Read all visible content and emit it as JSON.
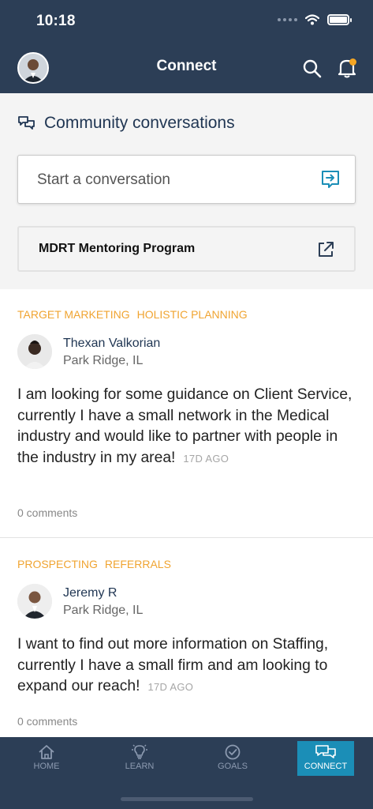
{
  "status_bar": {
    "time": "10:18"
  },
  "header": {
    "title": "Connect"
  },
  "community": {
    "title": "Community conversations",
    "start_placeholder": "Start a conversation",
    "mentoring_label": "MDRT Mentoring Program"
  },
  "posts": [
    {
      "tags": [
        "TARGET MARKETING",
        "HOLISTIC PLANNING"
      ],
      "author": "Thexan Valkorian",
      "location": "Park Ridge, IL",
      "body": "I am looking for some guidance on Client Service, currently I have a small network in the Medical industry and would like to partner with people in the industry in my area!",
      "age": "17D AGO",
      "comments": "0 comments"
    },
    {
      "tags": [
        "PROSPECTING",
        "REFERRALS"
      ],
      "author": "Jeremy R",
      "location": "Park Ridge, IL",
      "body": "I want to find out more information on Staffing, currently I have a small firm and am looking to expand our reach!",
      "age": "17D AGO",
      "comments": "0 comments"
    }
  ],
  "tabbar": {
    "items": [
      {
        "label": "HOME",
        "icon": "home-icon",
        "active": false
      },
      {
        "label": "LEARN",
        "icon": "lightbulb-icon",
        "active": false
      },
      {
        "label": "GOALS",
        "icon": "check-circle-icon",
        "active": false
      },
      {
        "label": "CONNECT",
        "icon": "chat-bubbles-icon",
        "active": true
      }
    ]
  },
  "colors": {
    "header_bg": "#2c3e56",
    "accent_tag": "#f0a431",
    "active_tab": "#1b8eb7",
    "notification_dot": "#f5a623"
  }
}
